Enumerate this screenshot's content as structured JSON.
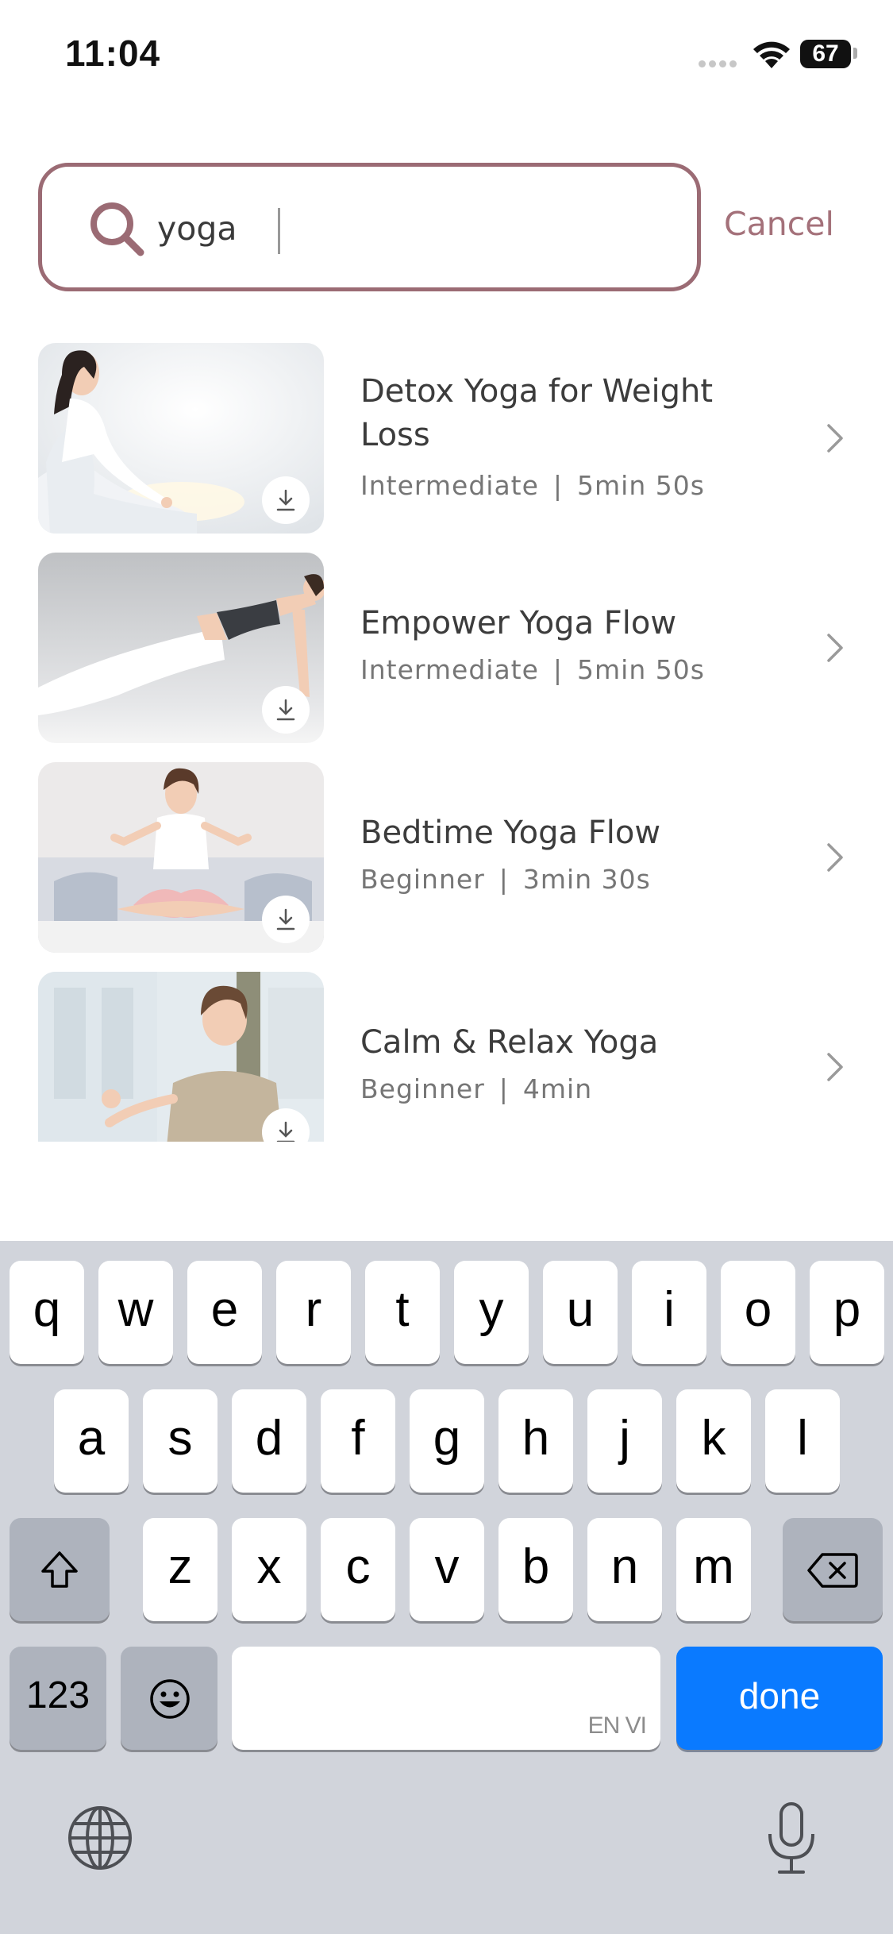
{
  "status_bar": {
    "time": "11:04",
    "battery": "67"
  },
  "search": {
    "value": "yoga",
    "cancel_label": "Cancel"
  },
  "results": [
    {
      "title": "Detox Yoga for Weight Loss",
      "level": "Intermediate",
      "separator": "|",
      "duration": "5min 50s"
    },
    {
      "title": "Empower Yoga Flow",
      "level": "Intermediate",
      "separator": "|",
      "duration": "5min 50s"
    },
    {
      "title": "Bedtime Yoga Flow",
      "level": "Beginner",
      "separator": "|",
      "duration": "3min 30s"
    },
    {
      "title": "Calm & Relax Yoga",
      "level": "Beginner",
      "separator": "|",
      "duration": "4min"
    }
  ],
  "keyboard": {
    "row1": [
      "q",
      "w",
      "e",
      "r",
      "t",
      "y",
      "u",
      "i",
      "o",
      "p"
    ],
    "row2": [
      "a",
      "s",
      "d",
      "f",
      "g",
      "h",
      "j",
      "k",
      "l"
    ],
    "row3": [
      "z",
      "x",
      "c",
      "v",
      "b",
      "n",
      "m"
    ],
    "numbers_label": "123",
    "space_lang": "EN VI",
    "done_label": "done"
  },
  "colors": {
    "accent": "#9b6b74",
    "cancel": "#a4717a",
    "done": "#0a7aff",
    "keyboard_bg": "#d1d4db"
  },
  "icons": [
    "search-icon",
    "download-icon",
    "chevron-right-icon",
    "shift-icon",
    "backspace-icon",
    "emoji-icon",
    "globe-icon",
    "mic-icon",
    "wifi-icon",
    "battery-icon"
  ]
}
